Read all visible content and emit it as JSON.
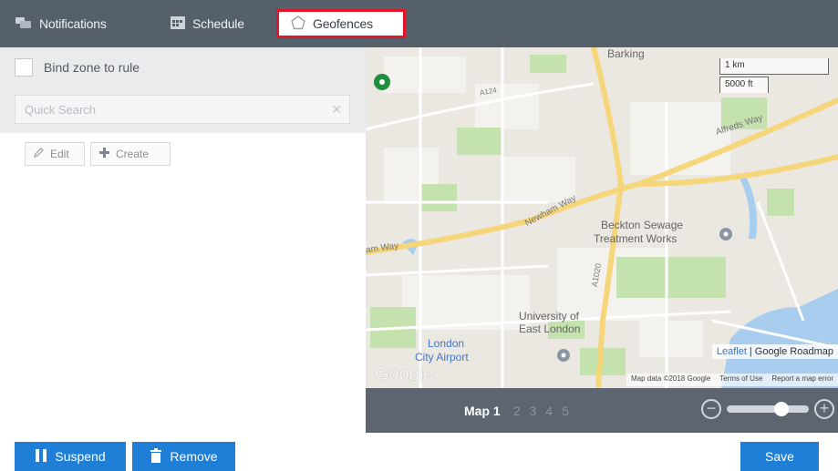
{
  "tabs": [
    {
      "label": "Notifications",
      "icon": "notifications-icon"
    },
    {
      "label": "Schedule",
      "icon": "calendar-icon"
    },
    {
      "label": "Geofences",
      "icon": "pentagon-icon",
      "active": true
    }
  ],
  "left_panel": {
    "bind_zone_label": "Bind zone to rule",
    "bind_zone_checked": false,
    "search_placeholder": "Quick Search",
    "edit_label": "Edit",
    "create_label": "Create"
  },
  "map": {
    "scale_km": "1 km",
    "scale_ft": "5000 ft",
    "places": {
      "barking": "Barking",
      "a124": "A124",
      "alfreds_way": "Alfreds Way",
      "newham_way": "Newham Way",
      "ham_way": "am Way",
      "beckton": "Beckton Sewage",
      "beckton2": "Treatment Works",
      "a1020": "A1020",
      "university": "University of",
      "university2": "East London",
      "london_airport": "London",
      "london_airport2": "City Airport"
    },
    "attribution_link": "Leaflet",
    "attribution_text": "Google Roadmap",
    "map_data": "Map data ©2018 Google",
    "terms": "Terms of Use",
    "report": "Report a map error",
    "google_logo": "Google",
    "colors": {
      "road_major": "#f6d67b",
      "water": "#a9cdee",
      "park": "#c4e2ad",
      "land": "#ebe7e1"
    }
  },
  "pager": {
    "items": [
      "Map 1",
      "2",
      "3",
      "4",
      "5"
    ],
    "active_index": 0
  },
  "zoom": {
    "level": 0.7
  },
  "bottom": {
    "suspend_label": "Suspend",
    "remove_label": "Remove",
    "save_label": "Save"
  },
  "colors": {
    "accent": "#1f7ed6",
    "tabbar": "#56606b",
    "active_tab_border": "#e2152a"
  }
}
